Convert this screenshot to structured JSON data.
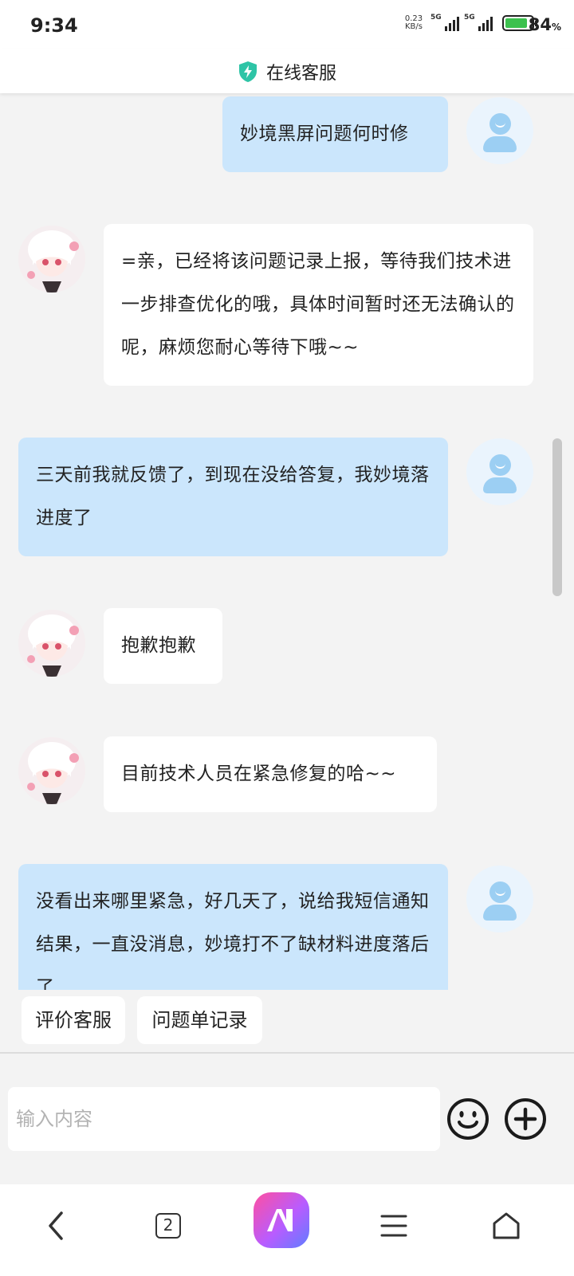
{
  "status_bar": {
    "time": "9:34",
    "net_speed_value": "0.23",
    "net_speed_unit": "KB/s",
    "signal1_label": "5G",
    "signal2_label": "5G",
    "battery_percent": "84",
    "battery_percent_sign": "%",
    "battery_level": 0.84
  },
  "header": {
    "title": "在线客服",
    "icon": "shield-lightning-icon",
    "accent_color": "#2ec4a6"
  },
  "messages": [
    {
      "sender": "user",
      "text": "妙境黑屏问题何时修"
    },
    {
      "sender": "agent",
      "text": "=亲，已经将该问题记录上报，等待我们技术进一步排查优化的哦，具体时间暂时还无法确认的呢，麻烦您耐心等待下哦~~"
    },
    {
      "sender": "user",
      "text": "三天前我就反馈了，到现在没给答复，我妙境落进度了"
    },
    {
      "sender": "agent",
      "text": "抱歉抱歉"
    },
    {
      "sender": "agent",
      "text": "目前技术人员在紧急修复的哈~~"
    },
    {
      "sender": "user",
      "text": "没看出来哪里紧急，好几天了，说给我短信通知结果，一直没消息，妙境打不了缺材料进度落后了"
    }
  ],
  "quick_actions": {
    "rate_label": "评价客服",
    "tickets_label": "问题单记录"
  },
  "input": {
    "placeholder": "输入内容"
  },
  "nav": {
    "tab_count": "2"
  },
  "colors": {
    "user_bubble": "#cbe6fc",
    "agent_bubble": "#ffffff",
    "background": "#f3f3f3",
    "battery_fill": "#3cc14e"
  }
}
